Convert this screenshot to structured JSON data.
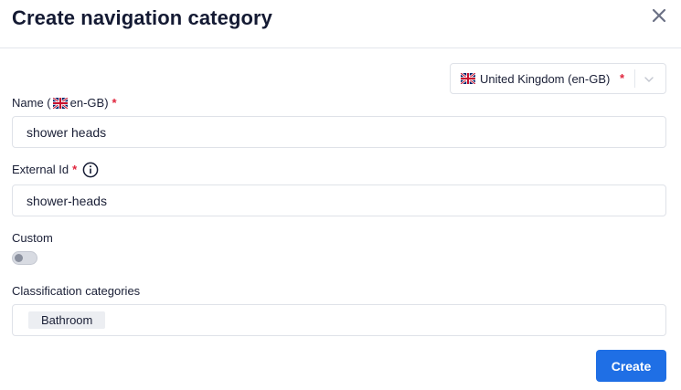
{
  "dialog": {
    "title": "Create navigation category"
  },
  "locale": {
    "selected": "United Kingdom (en-GB)",
    "required_mark": "*",
    "flag_icon": "uk-flag-icon"
  },
  "fields": {
    "name": {
      "label_prefix": "Name (",
      "label_locale": "en-GB",
      "label_suffix": ")",
      "required_mark": "*",
      "value": "shower heads"
    },
    "external_id": {
      "label": "External Id",
      "required_mark": "*",
      "value": "shower-heads",
      "info_icon": "info-icon"
    },
    "custom": {
      "label": "Custom",
      "enabled": false
    },
    "classification": {
      "label": "Classification categories",
      "chips": [
        "Bathroom"
      ]
    }
  },
  "actions": {
    "create_label": "Create"
  },
  "colors": {
    "primary": "#1f6fe5",
    "required": "#e0243c",
    "border": "#dfe2e8"
  }
}
